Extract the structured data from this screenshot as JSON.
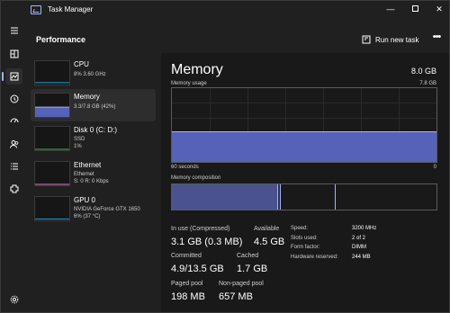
{
  "window": {
    "title": "Task Manager"
  },
  "nav": {
    "items": [
      {
        "icon": "hamburger-menu-icon"
      },
      {
        "icon": "processes-icon"
      },
      {
        "icon": "performance-icon",
        "active": true
      },
      {
        "icon": "app-history-icon"
      },
      {
        "icon": "startup-apps-icon"
      },
      {
        "icon": "users-icon"
      },
      {
        "icon": "details-icon"
      },
      {
        "icon": "services-icon"
      },
      {
        "icon": "settings-icon"
      }
    ]
  },
  "header": {
    "title": "Performance",
    "run_new_task_label": "Run new task",
    "more_label": "•••"
  },
  "devices": [
    {
      "name": "CPU",
      "sub1": "8% 3.60 GHz",
      "color": "#17a2d8",
      "usage": 0.08
    },
    {
      "name": "Memory",
      "sub1": "3.3/7.8 GB (42%)",
      "color": "#9fb6ff",
      "usage": 0.42,
      "selected": true
    },
    {
      "name": "Disk 0 (C: D:)",
      "sub1": "SSD",
      "sub2": "1%",
      "color": "#4caf50",
      "usage": 0.01
    },
    {
      "name": "Ethernet",
      "sub1": "Ethernet",
      "sub2": "S: 0 R: 0 Kbps",
      "color": "#e07fc4",
      "usage": 0.0
    },
    {
      "name": "GPU 0",
      "sub1": "NVIDIA GeForce GTX 1650",
      "sub2": "6% (37 °C)",
      "color": "#17a2d8",
      "usage": 0.06
    }
  ],
  "main": {
    "title": "Memory",
    "total": "8.0 GB",
    "usage_label": "Memory usage",
    "usage_max": "7.8 GB",
    "time_left": "60 seconds",
    "time_right": "0",
    "usage_fraction": 0.42,
    "composition_label": "Memory composition",
    "composition": {
      "in_use_fraction": 0.4,
      "modified_fraction": 0.01,
      "standby_fraction": 0.21,
      "free_fraction": 0.38
    },
    "stats": {
      "in_use_label": "In use (Compressed)",
      "in_use_value": "3.1 GB (0.3 MB)",
      "available_label": "Available",
      "available_value": "4.5 GB",
      "committed_label": "Committed",
      "committed_value": "4.9/13.5 GB",
      "cached_label": "Cached",
      "cached_value": "1.7 GB",
      "paged_label": "Paged pool",
      "paged_value": "198 MB",
      "nonpaged_label": "Non-paged pool",
      "nonpaged_value": "657 MB"
    },
    "details": [
      {
        "label": "Speed:",
        "value": "3200 MHz"
      },
      {
        "label": "Slots used:",
        "value": "2 of 2"
      },
      {
        "label": "Form factor:",
        "value": "DIMM"
      },
      {
        "label": "Hardware reserved:",
        "value": "244 MB"
      }
    ]
  },
  "colors": {
    "accent": "#9fb6ff",
    "memory_fill": "#5562b8",
    "background": "#202020"
  }
}
